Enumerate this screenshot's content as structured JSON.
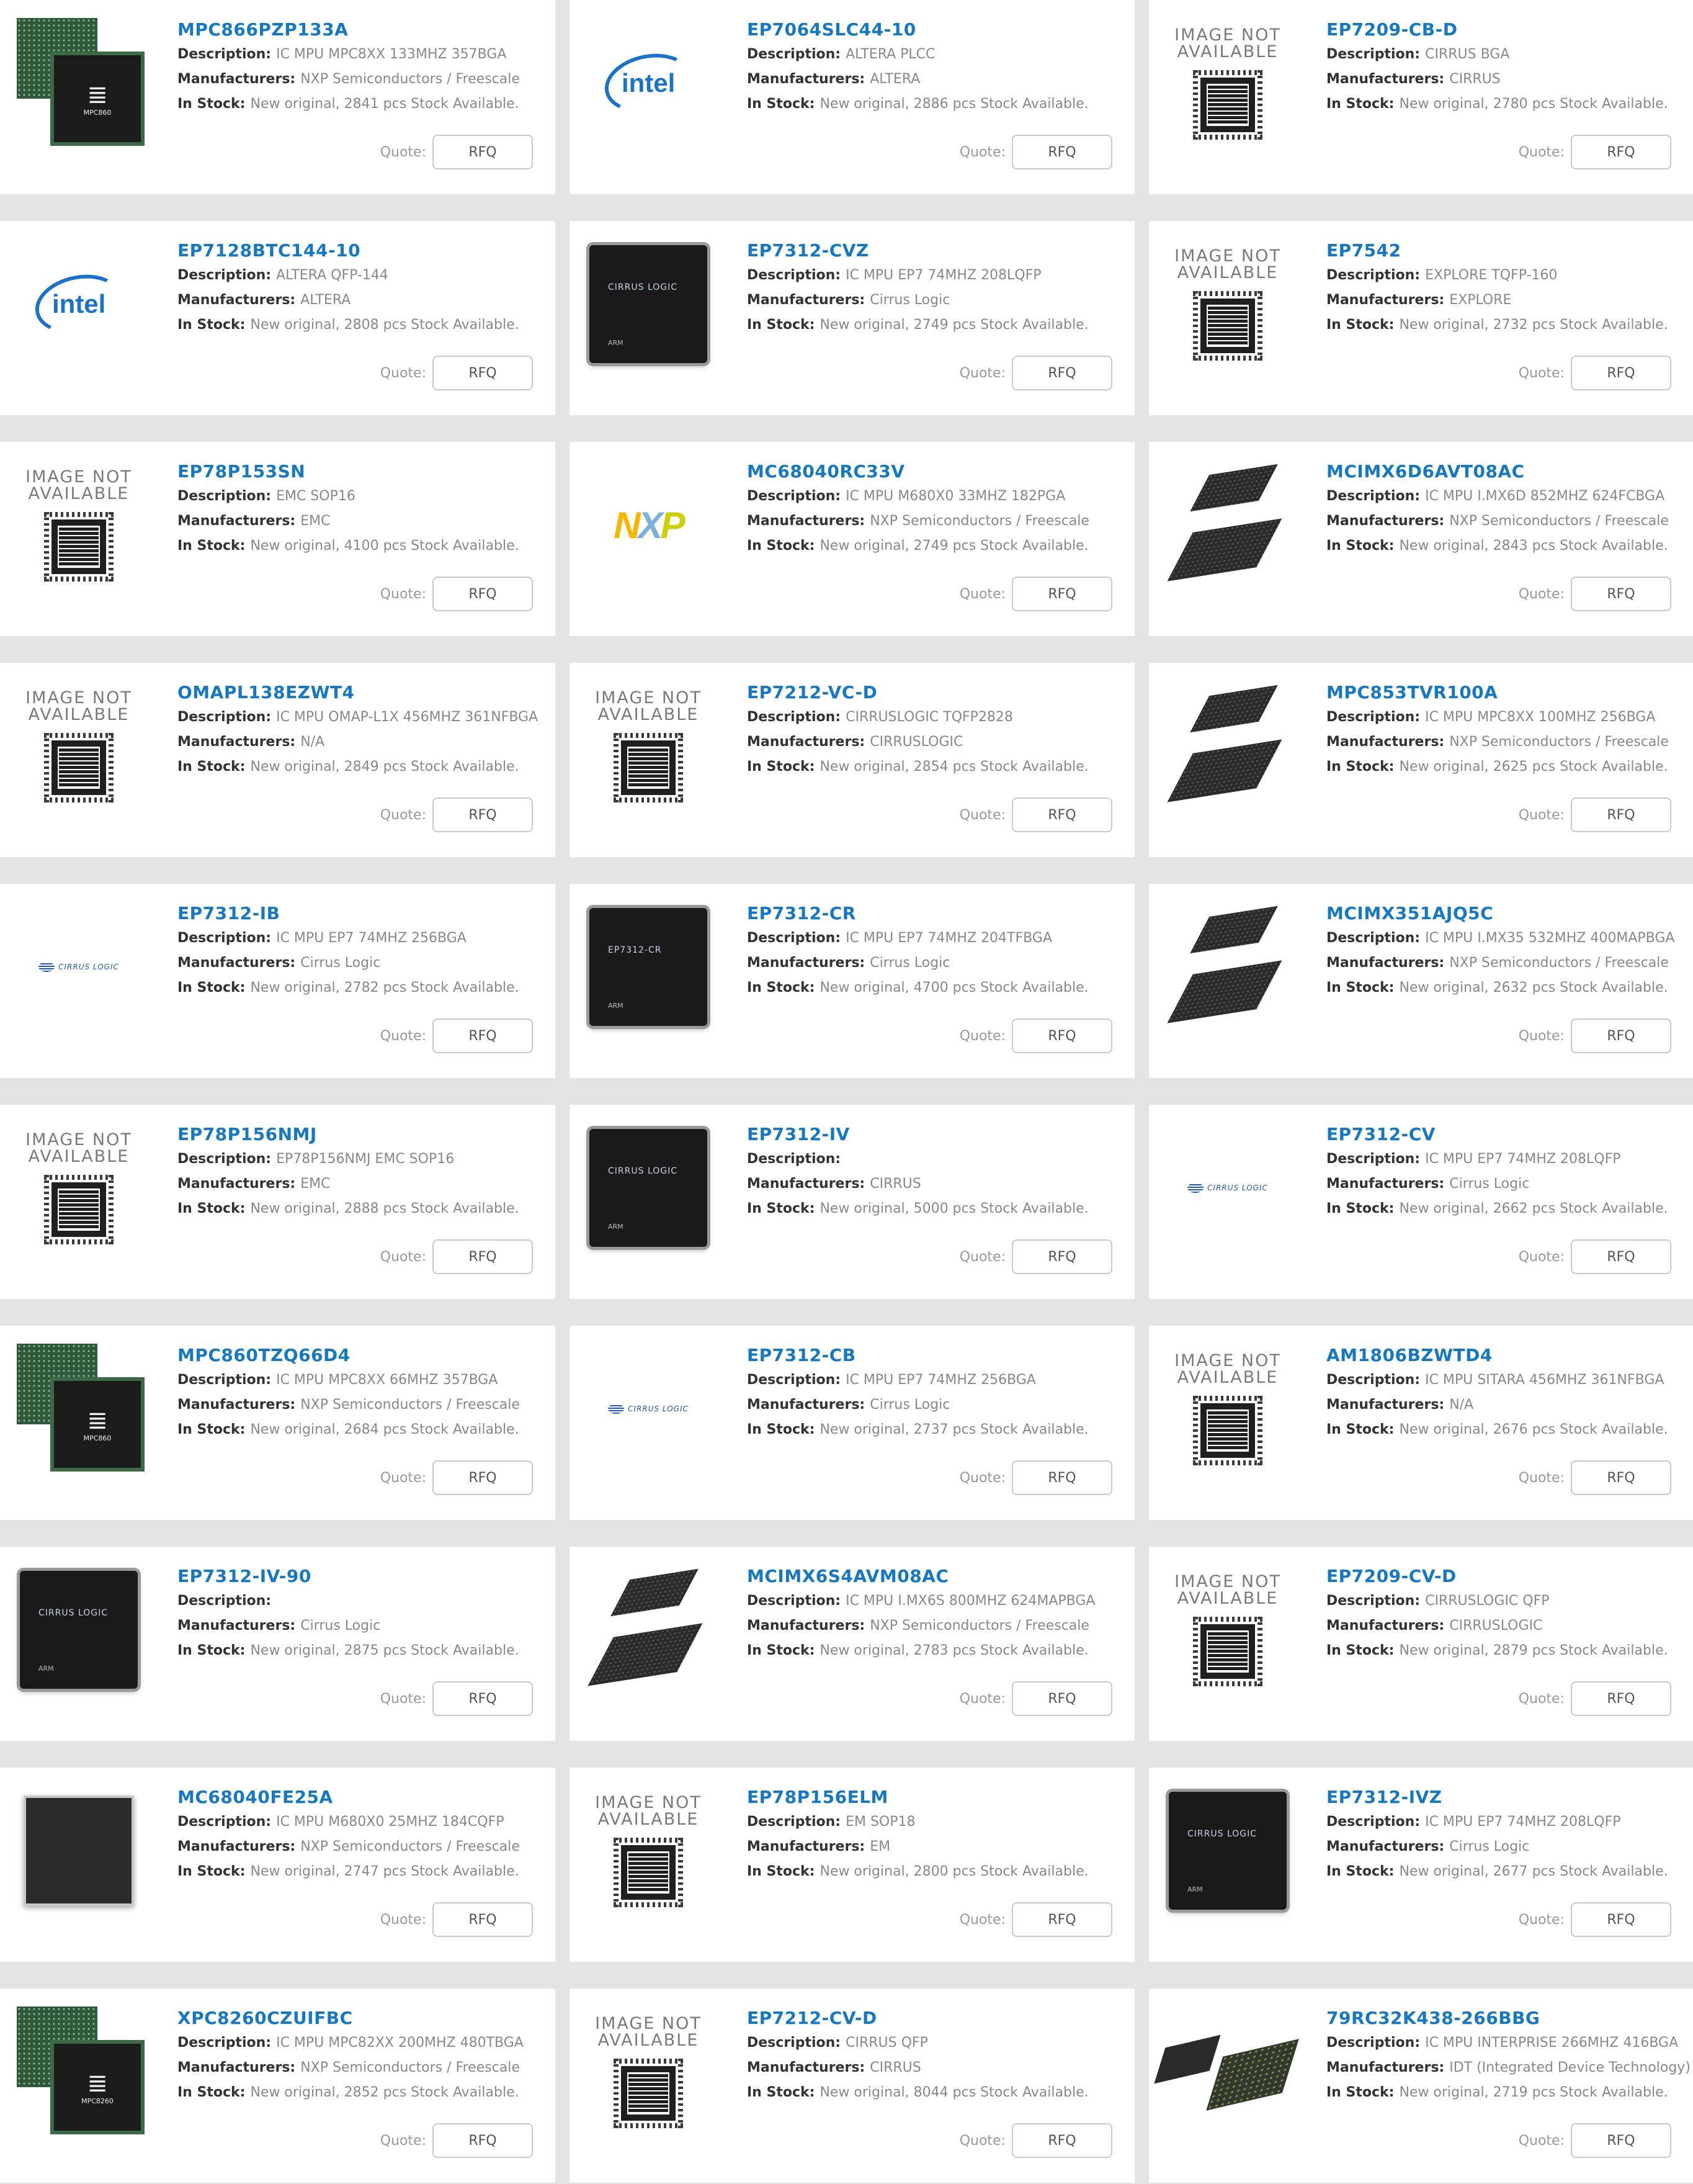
{
  "quote_label": "Quote:",
  "rfq_label": "RFQ",
  "labels": {
    "description": "Description:",
    "manufacturers": "Manufacturers:",
    "in_stock": "In Stock:"
  },
  "placeholder_text": [
    "IMAGE NOT",
    "AVAILABLE"
  ],
  "products": [
    {
      "pn": "MPC866PZP133A",
      "description": "IC MPU MPC8XX 133MHZ 357BGA",
      "manufacturer": "NXP Semiconductors / Freescale",
      "stock": "New original, 2841 pcs Stock Available.",
      "image": "freescale-chip",
      "chip_text": "MPC860"
    },
    {
      "pn": "EP7064SLC44-10",
      "description": "ALTERA PLCC",
      "manufacturer": "ALTERA",
      "stock": "New original, 2886 pcs Stock Available.",
      "image": "intel-logo",
      "chip_text": "intel"
    },
    {
      "pn": "EP7209-CB-D",
      "description": "CIRRUS BGA",
      "manufacturer": "CIRRUS",
      "stock": "New original, 2780 pcs Stock Available.",
      "image": "image-not-available"
    },
    {
      "pn": "EP7128BTC144-10",
      "description": "ALTERA QFP-144",
      "manufacturer": "ALTERA",
      "stock": "New original, 2808 pcs Stock Available.",
      "image": "intel-logo",
      "chip_text": "intel"
    },
    {
      "pn": "EP7312-CVZ",
      "description": "IC MPU EP7 74MHZ 208LQFP",
      "manufacturer": "Cirrus Logic",
      "stock": "New original, 2749 pcs Stock Available.",
      "image": "cirrus-qfp",
      "chip_text": "CIRRUS LOGIC"
    },
    {
      "pn": "EP7542",
      "description": "EXPLORE TQFP-160",
      "manufacturer": "EXPLORE",
      "stock": "New original, 2732 pcs Stock Available.",
      "image": "image-not-available"
    },
    {
      "pn": "EP78P153SN",
      "description": "EMC SOP16",
      "manufacturer": "EMC",
      "stock": "New original, 4100 pcs Stock Available.",
      "image": "image-not-available"
    },
    {
      "pn": "MC68040RC33V",
      "description": "IC MPU M680X0 33MHZ 182PGA",
      "manufacturer": "NXP Semiconductors / Freescale",
      "stock": "New original, 2749 pcs Stock Available.",
      "image": "nxp-logo",
      "chip_text": "NXP"
    },
    {
      "pn": "MCIMX6D6AVT08AC",
      "description": "IC MPU I.MX6D 852MHZ 624FCBGA",
      "manufacturer": "NXP Semiconductors / Freescale",
      "stock": "New original, 2843 pcs Stock Available.",
      "image": "bga-pair"
    },
    {
      "pn": "OMAPL138EZWT4",
      "description": "IC MPU OMAP-L1X 456MHZ 361NFBGA",
      "manufacturer": "N/A",
      "stock": "New original, 2849 pcs Stock Available.",
      "image": "image-not-available"
    },
    {
      "pn": "EP7212-VC-D",
      "description": "CIRRUSLOGIC TQFP2828",
      "manufacturer": "CIRRUSLOGIC",
      "stock": "New original, 2854 pcs Stock Available.",
      "image": "image-not-available"
    },
    {
      "pn": "MPC853TVR100A",
      "description": "IC MPU MPC8XX 100MHZ 256BGA",
      "manufacturer": "NXP Semiconductors / Freescale",
      "stock": "New original, 2625 pcs Stock Available.",
      "image": "bga-pair"
    },
    {
      "pn": "EP7312-IB",
      "description": "IC MPU EP7 74MHZ 256BGA",
      "manufacturer": "Cirrus Logic",
      "stock": "New original, 2782 pcs Stock Available.",
      "image": "cirrus-logo",
      "chip_text": "CIRRUS LOGIC"
    },
    {
      "pn": "EP7312-CR",
      "description": "IC MPU EP7 74MHZ 204TFBGA",
      "manufacturer": "Cirrus Logic",
      "stock": "New original, 4700 pcs Stock Available.",
      "image": "cirrus-qfp",
      "chip_text": "EP7312-CR"
    },
    {
      "pn": "MCIMX351AJQ5C",
      "description": "IC MPU I.MX35 532MHZ 400MAPBGA",
      "manufacturer": "NXP Semiconductors / Freescale",
      "stock": "New original, 2632 pcs Stock Available.",
      "image": "bga-pair"
    },
    {
      "pn": "EP78P156NMJ",
      "description": "EP78P156NMJ EMC SOP16",
      "manufacturer": "EMC",
      "stock": "New original, 2888 pcs Stock Available.",
      "image": "image-not-available"
    },
    {
      "pn": "EP7312-IV",
      "description": "",
      "manufacturer": "CIRRUS",
      "stock": "New original, 5000 pcs Stock Available.",
      "image": "cirrus-qfp",
      "chip_text": "CIRRUS LOGIC"
    },
    {
      "pn": "EP7312-CV",
      "description": "IC MPU EP7 74MHZ 208LQFP",
      "manufacturer": "Cirrus Logic",
      "stock": "New original, 2662 pcs Stock Available.",
      "image": "cirrus-logo",
      "chip_text": "CIRRUS LOGIC"
    },
    {
      "pn": "MPC860TZQ66D4",
      "description": "IC MPU MPC8XX 66MHZ 357BGA",
      "manufacturer": "NXP Semiconductors / Freescale",
      "stock": "New original, 2684 pcs Stock Available.",
      "image": "freescale-chip",
      "chip_text": "MPC860"
    },
    {
      "pn": "EP7312-CB",
      "description": "IC MPU EP7 74MHZ 256BGA",
      "manufacturer": "Cirrus Logic",
      "stock": "New original, 2737 pcs Stock Available.",
      "image": "cirrus-logo",
      "chip_text": "CIRRUS LOGIC"
    },
    {
      "pn": "AM1806BZWTD4",
      "description": "IC MPU SITARA 456MHZ 361NFBGA",
      "manufacturer": "N/A",
      "stock": "New original, 2676 pcs Stock Available.",
      "image": "image-not-available"
    },
    {
      "pn": "EP7312-IV-90",
      "description": "",
      "manufacturer": "Cirrus Logic",
      "stock": "New original, 2875 pcs Stock Available.",
      "image": "cirrus-qfp",
      "chip_text": "CIRRUS LOGIC"
    },
    {
      "pn": "MCIMX6S4AVM08AC",
      "description": "IC MPU I.MX6S 800MHZ 624MAPBGA",
      "manufacturer": "NXP Semiconductors / Freescale",
      "stock": "New original, 2783 pcs Stock Available.",
      "image": "bga-pair"
    },
    {
      "pn": "EP7209-CV-D",
      "description": "CIRRUSLOGIC QFP",
      "manufacturer": "CIRRUSLOGIC",
      "stock": "New original, 2879 pcs Stock Available.",
      "image": "image-not-available"
    },
    {
      "pn": "MC68040FE25A",
      "description": "IC MPU M680X0 25MHZ 184CQFP",
      "manufacturer": "NXP Semiconductors / Freescale",
      "stock": "New original, 2747 pcs Stock Available.",
      "image": "plain-chip"
    },
    {
      "pn": "EP78P156ELM",
      "description": "EM SOP18",
      "manufacturer": "EM",
      "stock": "New original, 2800 pcs Stock Available.",
      "image": "image-not-available"
    },
    {
      "pn": "EP7312-IVZ",
      "description": "IC MPU EP7 74MHZ 208LQFP",
      "manufacturer": "Cirrus Logic",
      "stock": "New original, 2677 pcs Stock Available.",
      "image": "cirrus-qfp",
      "chip_text": "CIRRUS LOGIC"
    },
    {
      "pn": "XPC8260CZUIFBC",
      "description": "IC MPU MPC82XX 200MHZ 480TBGA",
      "manufacturer": "NXP Semiconductors / Freescale",
      "stock": "New original, 2852 pcs Stock Available.",
      "image": "freescale-chip",
      "chip_text": "MPC8260"
    },
    {
      "pn": "EP7212-CV-D",
      "description": "CIRRUS QFP",
      "manufacturer": "CIRRUS",
      "stock": "New original, 8044 pcs Stock Available.",
      "image": "image-not-available"
    },
    {
      "pn": "79RC32K438-266BBG",
      "description": "IC MPU INTERPRISE 266MHZ 416BGA",
      "manufacturer": "IDT (Integrated Device Technology)",
      "stock": "New original, 2719 pcs Stock Available.",
      "image": "idt-chip"
    }
  ]
}
